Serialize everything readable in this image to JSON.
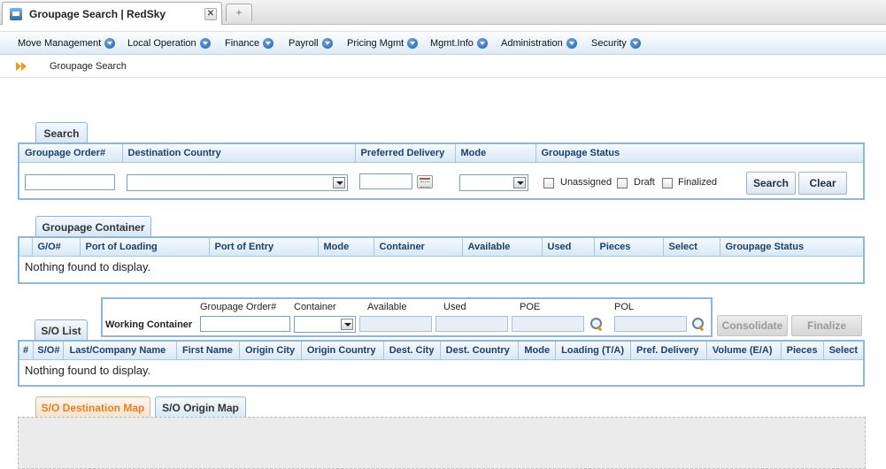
{
  "browser": {
    "tab_title": "Groupage Search | RedSky",
    "new_tab_glyph": "+"
  },
  "menu": [
    {
      "label": "Move Management"
    },
    {
      "label": "Local Operation"
    },
    {
      "label": "Finance"
    },
    {
      "label": "Payroll"
    },
    {
      "label": "Pricing Mgmt"
    },
    {
      "label": "Mgmt.Info"
    },
    {
      "label": "Administration"
    },
    {
      "label": "Security"
    }
  ],
  "breadcrumb": {
    "icon": "double-arrow-icon",
    "label": "Groupage Search"
  },
  "search": {
    "tab_label": "Search",
    "headers": [
      "Groupage Order#",
      "Destination Country",
      "Preferred Delivery",
      "Mode",
      "Groupage Status"
    ],
    "status_options": [
      "Unassigned",
      "Draft",
      "Finalized"
    ],
    "search_button": "Search",
    "clear_button": "Clear"
  },
  "container": {
    "tab_label": "Groupage Container",
    "headers": [
      "G/O#",
      "Port of Loading",
      "Port of Entry",
      "Mode",
      "Container",
      "Available",
      "Used",
      "Pieces",
      "Select",
      "Groupage Status"
    ],
    "empty_text": "Nothing found to display."
  },
  "working": {
    "label": "Working Container",
    "fields": [
      "Groupage Order#",
      "Container",
      "Available",
      "Used",
      "POE",
      "POL"
    ],
    "consolidate_button": "Consolidate",
    "finalize_button": "Finalize"
  },
  "solist": {
    "tab_label": "S/O List",
    "headers": [
      "#",
      "S/O#",
      "Last/Company Name",
      "First Name",
      "Origin City",
      "Origin Country",
      "Dest. City",
      "Dest. Country",
      "Mode",
      "Loading (T/A)",
      "Pref. Delivery",
      "Volume (E/A)",
      "Pieces",
      "Select"
    ],
    "empty_text": "Nothing found to display."
  },
  "maps": {
    "tabs": [
      "S/O Destination Map",
      "S/O Origin Map"
    ],
    "active_color": "#e8801a"
  }
}
